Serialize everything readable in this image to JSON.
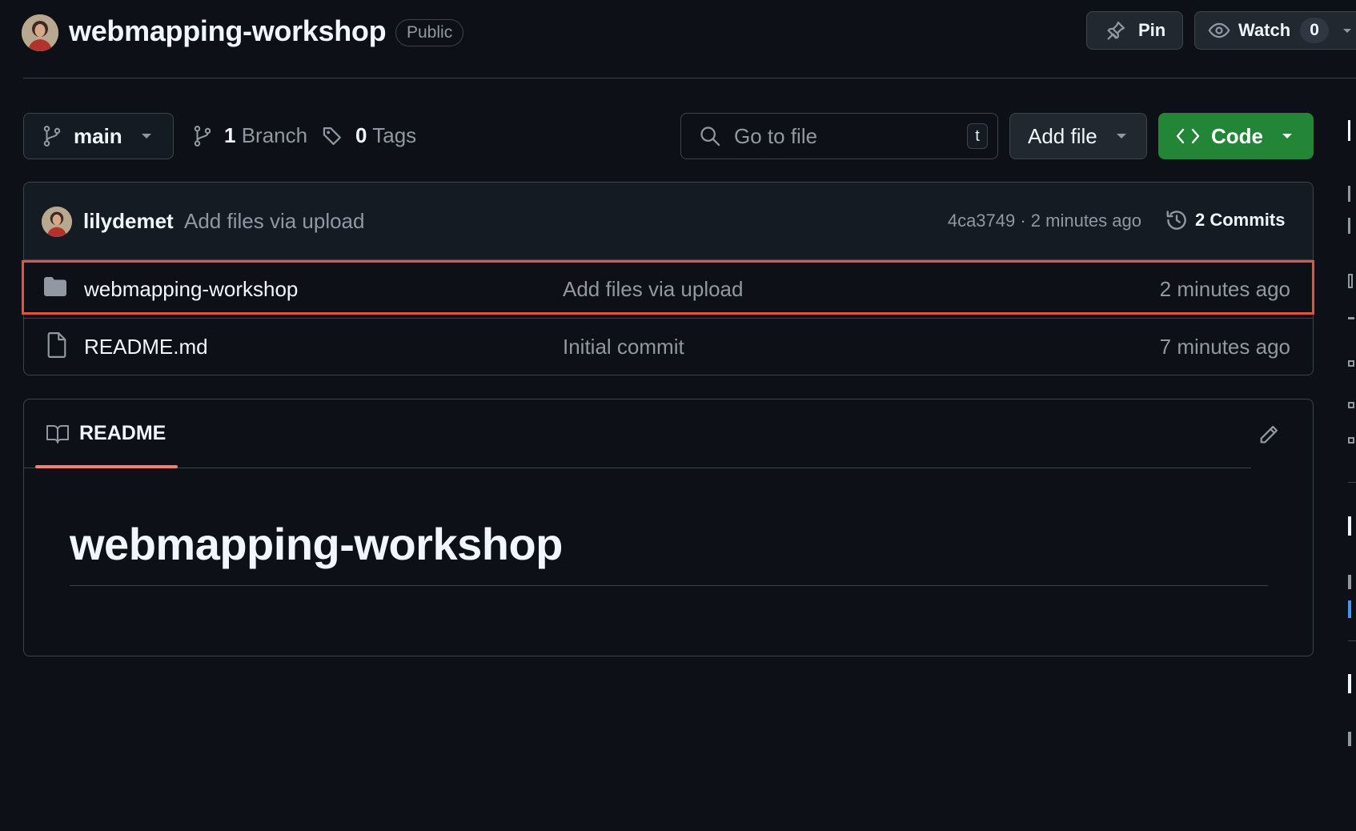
{
  "repo": {
    "name": "webmapping-workshop",
    "visibility": "Public"
  },
  "header_actions": {
    "pin_label": "Pin",
    "watch_label": "Watch",
    "watch_count": "0"
  },
  "toolbar": {
    "branch": "main",
    "branch_count": "1",
    "branch_label": "Branch",
    "tag_count": "0",
    "tag_label": "Tags",
    "search_placeholder": "Go to file",
    "search_shortcut": "t",
    "add_file_label": "Add file",
    "code_label": "Code"
  },
  "latest_commit": {
    "author": "lilydemet",
    "message": "Add files via upload",
    "hash_time": "4ca3749 · 2 minutes ago",
    "commits_label": "2 Commits"
  },
  "files": [
    {
      "name": "webmapping-workshop",
      "type": "folder",
      "message": "Add files via upload",
      "time": "2 minutes ago"
    },
    {
      "name": "README.md",
      "type": "file",
      "message": "Initial commit",
      "time": "7 minutes ago"
    }
  ],
  "readme": {
    "tab_label": "README",
    "heading": "webmapping-workshop"
  },
  "colors": {
    "background": "#0d1117",
    "border": "#3d444d",
    "code_button": "#238636",
    "highlight": "#e5533c",
    "tab_underline": "#f78166"
  }
}
